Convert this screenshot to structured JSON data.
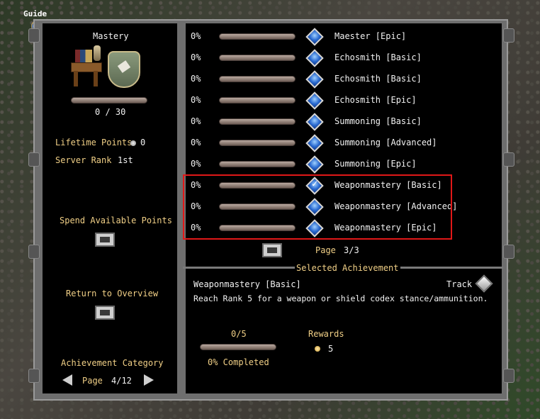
{
  "guide": {
    "label": "Guide"
  },
  "left": {
    "title": "Mastery",
    "points_progress": {
      "text": "0 / 30",
      "fraction": 0
    },
    "lifetime_points": {
      "label": "Lifetime Points",
      "value": "0"
    },
    "server_rank": {
      "label": "Server Rank",
      "value": "1st"
    },
    "spend_points": {
      "label": "Spend Available Points"
    },
    "return_overview": {
      "label": "Return to Overview"
    },
    "category": {
      "label": "Achievement Category",
      "page_label": "Page",
      "page_value": "4/12"
    }
  },
  "achievements": [
    {
      "percent": "0%",
      "progress": 0,
      "name": "Maester [Epic]",
      "completed": false
    },
    {
      "percent": "0%",
      "progress": 0,
      "name": "Echosmith [Basic]",
      "completed": false
    },
    {
      "percent": "0%",
      "progress": 0,
      "name": "Echosmith [Basic]",
      "completed": false
    },
    {
      "percent": "0%",
      "progress": 0,
      "name": "Echosmith [Epic]",
      "completed": false
    },
    {
      "percent": "0%",
      "progress": 0,
      "name": "Summoning [Basic]",
      "completed": false
    },
    {
      "percent": "0%",
      "progress": 0,
      "name": "Summoning [Advanced]",
      "completed": false
    },
    {
      "percent": "0%",
      "progress": 0,
      "name": "Summoning [Epic]",
      "completed": false
    },
    {
      "percent": "0%",
      "progress": 0,
      "name": "Weaponmastery [Basic]",
      "completed": true
    },
    {
      "percent": "0%",
      "progress": 0,
      "name": "Weaponmastery [Advanced]",
      "completed": false
    },
    {
      "percent": "0%",
      "progress": 0,
      "name": "Weaponmastery [Epic]",
      "completed": false
    }
  ],
  "list_pager": {
    "label": "Page",
    "value": "3/3"
  },
  "selected": {
    "header": "Selected Achievement",
    "name": "Weaponmastery [Basic]",
    "track_label": "Track",
    "description": "Reach Rank 5 for a weapon or shield codex stance/ammunition.",
    "progress_text": "0/5",
    "progress": 0,
    "completed_text": "0% Completed",
    "rewards_label": "Rewards",
    "rewards_value": "5"
  },
  "colors": {
    "highlight": "#e01818",
    "label_gold": "#f0cf86",
    "text_white": "#f2f2f2"
  }
}
